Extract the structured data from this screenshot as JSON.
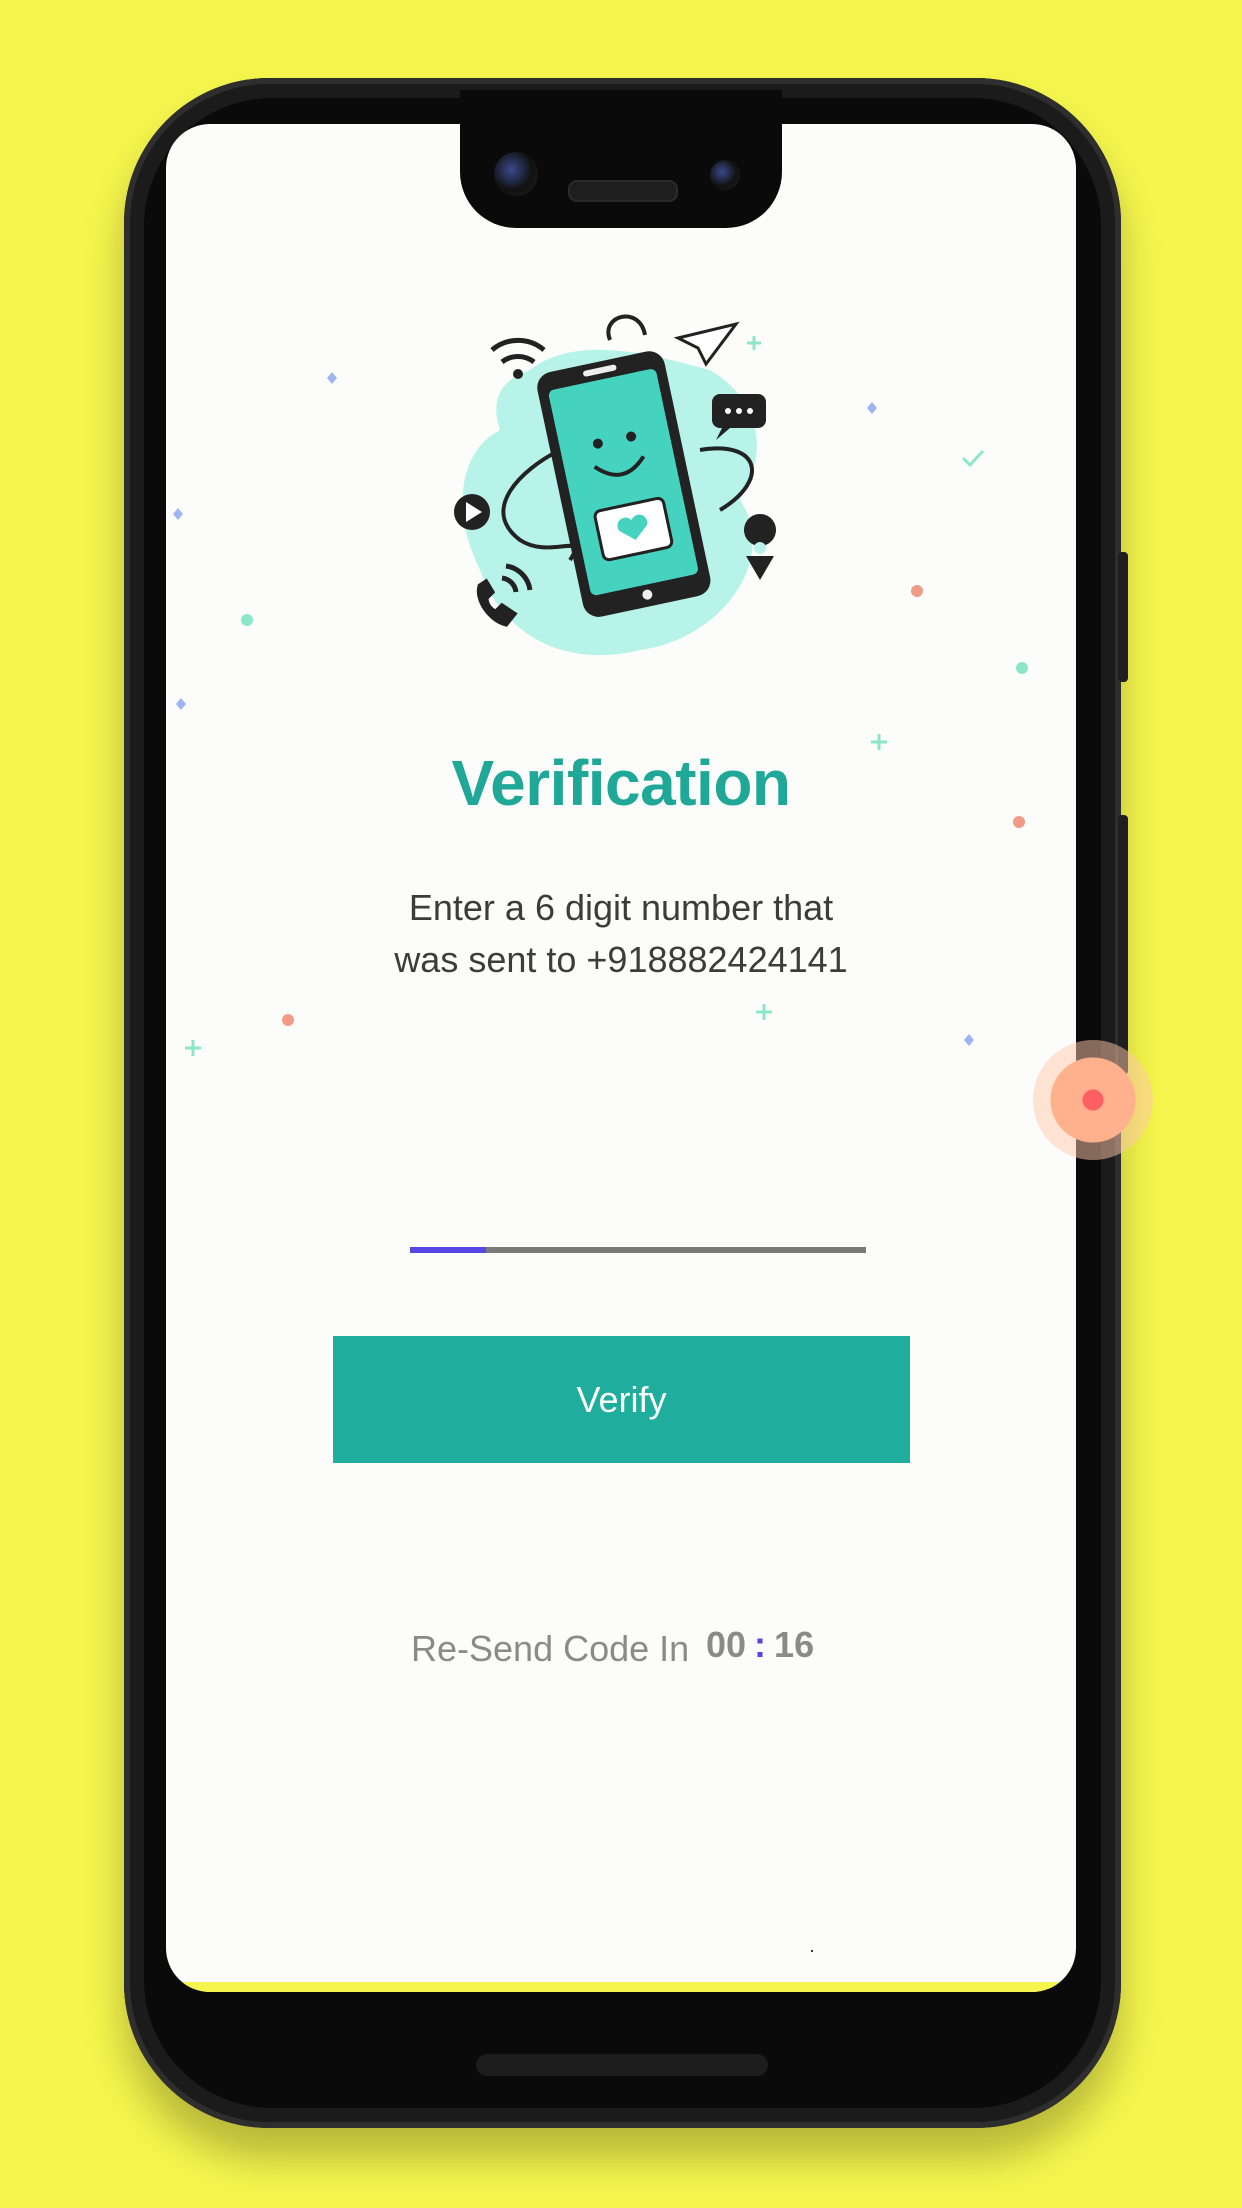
{
  "screen": {
    "title": "Verification",
    "subtitle_line1": "Enter a 6 digit number that",
    "subtitle_line2": "was sent to +918882424141",
    "otp": {
      "length": 6,
      "active_index": 0,
      "value": ""
    },
    "verify_button_label": "Verify",
    "resend_label": "Re-Send Code In",
    "timer": {
      "minutes": "00",
      "separator": ":",
      "seconds": "16"
    }
  },
  "colors": {
    "background": "#f5f54d",
    "accent": "#1fae9d",
    "title": "#1fa898",
    "otp_active": "#5646e6",
    "otp_inactive": "#7a7a7a"
  },
  "icons": [
    "phone-illustration-icon",
    "wifi-icon",
    "paper-plane-icon",
    "chat-bubble-icon",
    "play-icon",
    "location-pin-icon",
    "phone-call-icon",
    "heart-message-icon"
  ]
}
